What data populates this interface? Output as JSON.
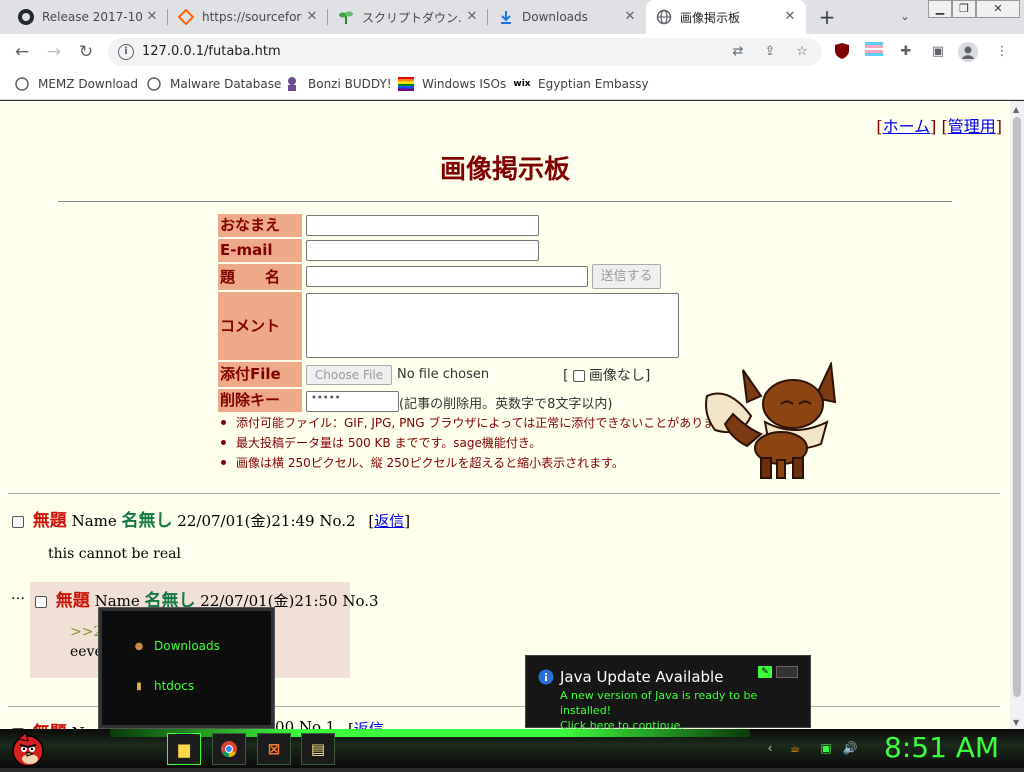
{
  "browser": {
    "tabs": [
      {
        "label": "Release 2017-10-...",
        "icon": "github-icon"
      },
      {
        "label": "https://sourceforg...",
        "icon": "sourceforge-icon"
      },
      {
        "label": "スクリプトダウン...",
        "icon": "sprout-icon"
      },
      {
        "label": "Downloads",
        "icon": "download-icon"
      },
      {
        "label": "画像掲示板",
        "icon": "globe-icon"
      }
    ],
    "new_tab": "+",
    "url": "127.0.0.1/futaba.htm",
    "bookmarks": [
      {
        "label": "MEMZ Download"
      },
      {
        "label": "Malware Database"
      },
      {
        "label": "Bonzi BUDDY!"
      },
      {
        "label": "Windows ISOs"
      },
      {
        "label": "Egyptian Embassy"
      }
    ]
  },
  "page": {
    "links": {
      "open": "[",
      "home": "ホーム",
      "mid": "] [",
      "admin": "管理用",
      "close": "]"
    },
    "title": "画像掲示板",
    "form": {
      "name_label": "おなまえ",
      "email_label": "E-mail",
      "subject_label": "題　　名",
      "submit": "送信する",
      "comment_label": "コメント",
      "file_label": "添付File",
      "file_button": "Choose File",
      "file_status": "No file chosen",
      "noimage_open": "[",
      "noimage_label": "画像なし",
      "noimage_close": "]",
      "delete_label": "削除キー",
      "delete_value": "•••••",
      "delete_note": "(記事の削除用。英数字で8文字以内)"
    },
    "notes": [
      "添付可能ファイル：GIF, JPG, PNG ブラウザによっては正常に添付できないことがあります。",
      "最大投稿データ量は 500 KB までです。sage機能付き。",
      "画像は横 250ピクセル、縦 250ピクセルを超えると縮小表示されます。"
    ],
    "posts": [
      {
        "subject": "無題",
        "name_label": "Name",
        "name": "名無し",
        "datetime": "22/07/01(金)21:49 No.2",
        "reply_open": "[",
        "reply": "返信",
        "reply_close": "]",
        "body": "this cannot be real"
      },
      {
        "dots": "…",
        "subject": "無題",
        "name_label": "Name",
        "name": "名無し",
        "datetime": "22/07/01(金)21:50 No.3",
        "quote": ">>2",
        "body": "eeve"
      },
      {
        "subject": "無題",
        "name_label": "N",
        "datetime": ":00 No.1",
        "reply_open": "[",
        "reply": "返信"
      }
    ]
  },
  "jumplist": {
    "items": [
      {
        "label": "Downloads"
      },
      {
        "label": "htdocs"
      }
    ]
  },
  "notification": {
    "title": "Java Update Available",
    "line1": "A new version of Java is ready to be installed!",
    "line2": "Click here to continue."
  },
  "taskbar": {
    "clock": "8:51 AM"
  }
}
